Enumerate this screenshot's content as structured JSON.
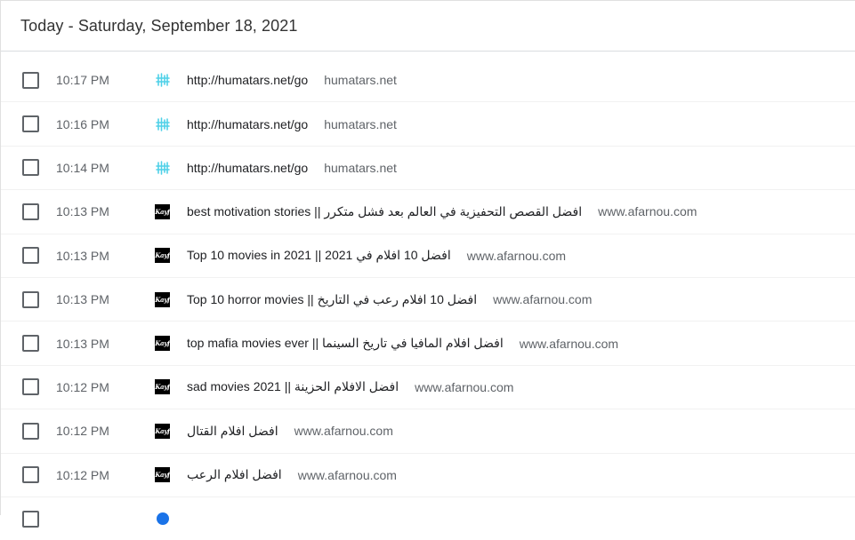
{
  "header": {
    "title": "Today - Saturday, September 18, 2021"
  },
  "entries": [
    {
      "time": "10:17 PM",
      "title": "http://humatars.net/go",
      "domain": "humatars.net",
      "favicon": "humatars-icon"
    },
    {
      "time": "10:16 PM",
      "title": "http://humatars.net/go",
      "domain": "humatars.net",
      "favicon": "humatars-icon"
    },
    {
      "time": "10:14 PM",
      "title": "http://humatars.net/go",
      "domain": "humatars.net",
      "favicon": "humatars-icon"
    },
    {
      "time": "10:13 PM",
      "title": "افضل القصص التحفيزية في العالم بعد فشل متكرر || best motivation stories",
      "domain": "www.afarnou.com",
      "favicon": "kayf-icon"
    },
    {
      "time": "10:13 PM",
      "title": "افضل 10 افلام في 2021 || Top 10 movies in 2021",
      "domain": "www.afarnou.com",
      "favicon": "kayf-icon"
    },
    {
      "time": "10:13 PM",
      "title": "افضل 10 افلام رعب في التاريخ || Top 10 horror movies",
      "domain": "www.afarnou.com",
      "favicon": "kayf-icon"
    },
    {
      "time": "10:13 PM",
      "title": "افضل افلام المافيا في تاريخ السينما || top mafia movies ever",
      "domain": "www.afarnou.com",
      "favicon": "kayf-icon"
    },
    {
      "time": "10:12 PM",
      "title": "افضل الافلام الحزينة || sad movies 2021",
      "domain": "www.afarnou.com",
      "favicon": "kayf-icon"
    },
    {
      "time": "10:12 PM",
      "title": "افضل افلام القتال",
      "domain": "www.afarnou.com",
      "favicon": "kayf-icon"
    },
    {
      "time": "10:12 PM",
      "title": "افضل افلام الرعب",
      "domain": "www.afarnou.com",
      "favicon": "kayf-icon"
    },
    {
      "time": "",
      "title": "",
      "domain": "",
      "favicon": "circle-icon"
    }
  ],
  "icons": {
    "kayf_text": "Kayf"
  },
  "colors": {
    "humatars_icon": "#4fd1e8",
    "kayf_icon_bg": "#000000",
    "circle_icon": "#1a73e8"
  }
}
